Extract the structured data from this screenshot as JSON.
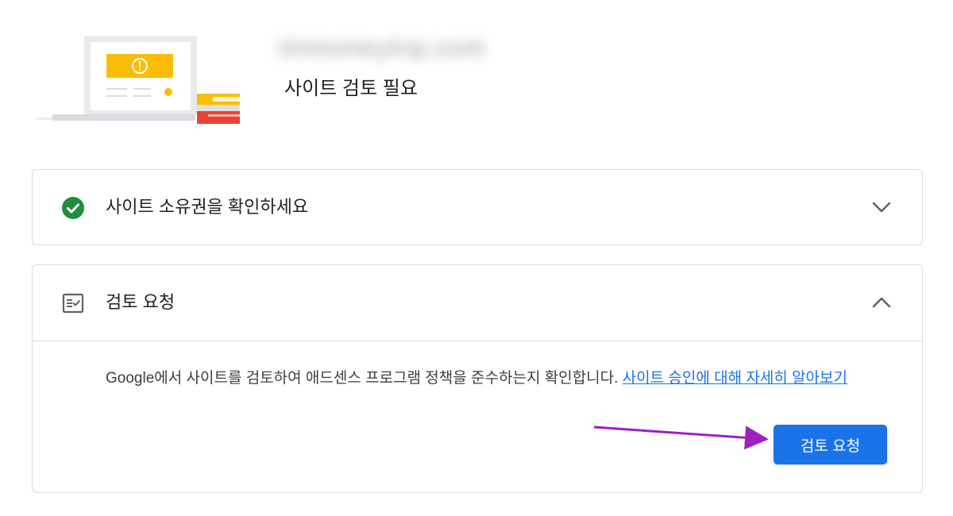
{
  "header": {
    "site_url": "tinmoneytrip.com",
    "site_status": "사이트 검토 필요"
  },
  "ownership_card": {
    "title": "사이트 소유권을 확인하세요",
    "status_icon": "check-circle-icon",
    "expanded": false
  },
  "review_card": {
    "title": "검토 요청",
    "icon": "checklist-icon",
    "expanded": true,
    "description": "Google에서 사이트를 검토하여 애드센스 프로그램 정책을 준수하는지 확인합니다.",
    "learn_more_link": "사이트 승인에 대해 자세히 알아보기",
    "button_label": "검토 요청"
  },
  "colors": {
    "accent": "#1a73e8",
    "success": "#1e8e3e",
    "warning": "#fbbc04",
    "annotation_arrow": "#a020c0"
  }
}
